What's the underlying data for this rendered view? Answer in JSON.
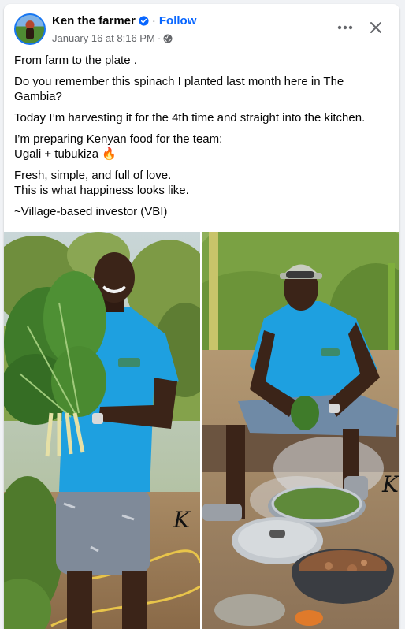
{
  "post": {
    "author": "Ken the farmer",
    "separator": "·",
    "follow_label": "Follow",
    "timestamp": "January 16 at 8:16 PM",
    "meta_separator": "·",
    "audience_icon": "globe-icon",
    "verified_icon": "verified-badge-icon",
    "more_icon": "more-horizontal-icon",
    "close_icon": "close-icon",
    "paragraphs": [
      "From farm to the plate .",
      "Do you remember this spinach I planted last month here in The Gambia?",
      "Today I’m harvesting it for the 4th time and straight into the kitchen.",
      "I’m preparing Kenyan food for the team:\nUgali + tubukiza 🔥",
      "Fresh, simple, and full of love.\nThis is what happiness looks like.",
      "~Village-based investor (VBI)"
    ]
  },
  "colors": {
    "accent": "#0866ff",
    "verified": "#0866ff",
    "shirt": "#1ea0e0",
    "background": "#f0f2f5"
  }
}
